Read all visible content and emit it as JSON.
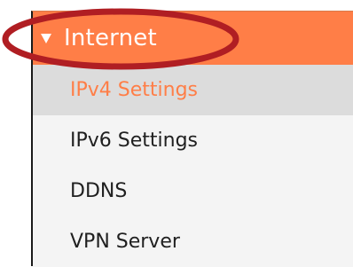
{
  "menu": {
    "header": {
      "label": "Internet",
      "expanded": true,
      "icon": "triangle-down-icon",
      "color": "#ff7e47"
    },
    "items": [
      {
        "label": "IPv4 Settings",
        "active": true
      },
      {
        "label": "IPv6 Settings",
        "active": false
      },
      {
        "label": "DDNS",
        "active": false
      },
      {
        "label": "VPN Server",
        "active": false
      }
    ],
    "active_color": "#ff7e47"
  },
  "annotation": {
    "shape": "ellipse",
    "color": "#b01e23"
  }
}
